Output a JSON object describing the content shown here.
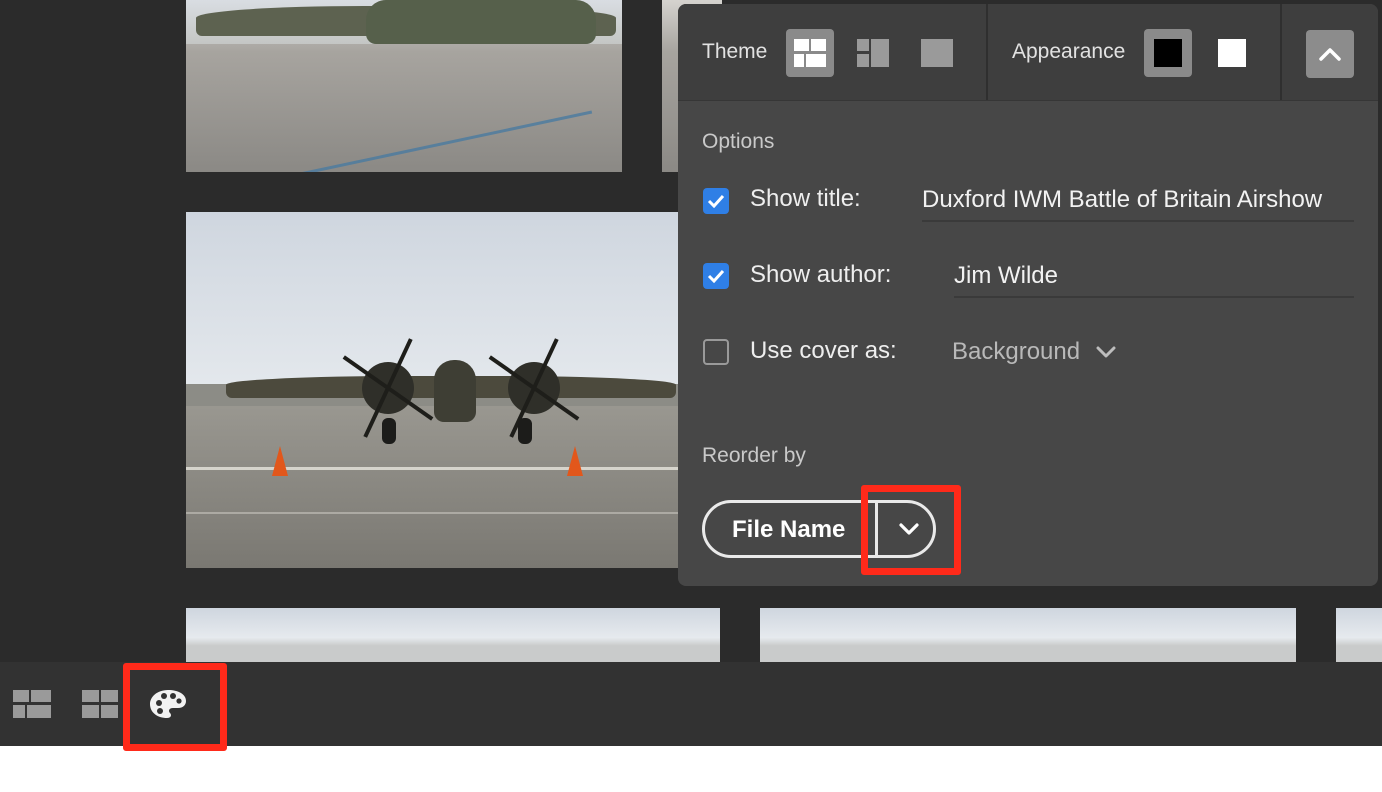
{
  "panel": {
    "theme_label": "Theme",
    "appearance_label": "Appearance",
    "options_title": "Options",
    "options": [
      {
        "label": "Show title:",
        "checked": true,
        "value": "Duxford IWM Battle of Britain Airshow"
      },
      {
        "label": "Show author:",
        "checked": true,
        "value": "Jim Wilde"
      },
      {
        "label": "Use cover as:",
        "checked": false,
        "value": "Background"
      }
    ],
    "reorder_title": "Reorder by",
    "reorder_value": "File Name"
  },
  "colors": {
    "accent": "#2f7fe6",
    "highlight": "#ff2a1a",
    "panel_bg": "#474747",
    "page_bg": "#2b2b2b"
  },
  "icons": {
    "theme_options": [
      "mosaic-layout-icon",
      "grid-layout-icon",
      "single-layout-icon"
    ],
    "appearance_options": [
      "dark-swatch-icon",
      "light-swatch-icon"
    ],
    "collapse": "chevron-up-icon",
    "toolbar": [
      "mosaic-layout-icon",
      "grid-layout-icon",
      "palette-icon"
    ]
  }
}
